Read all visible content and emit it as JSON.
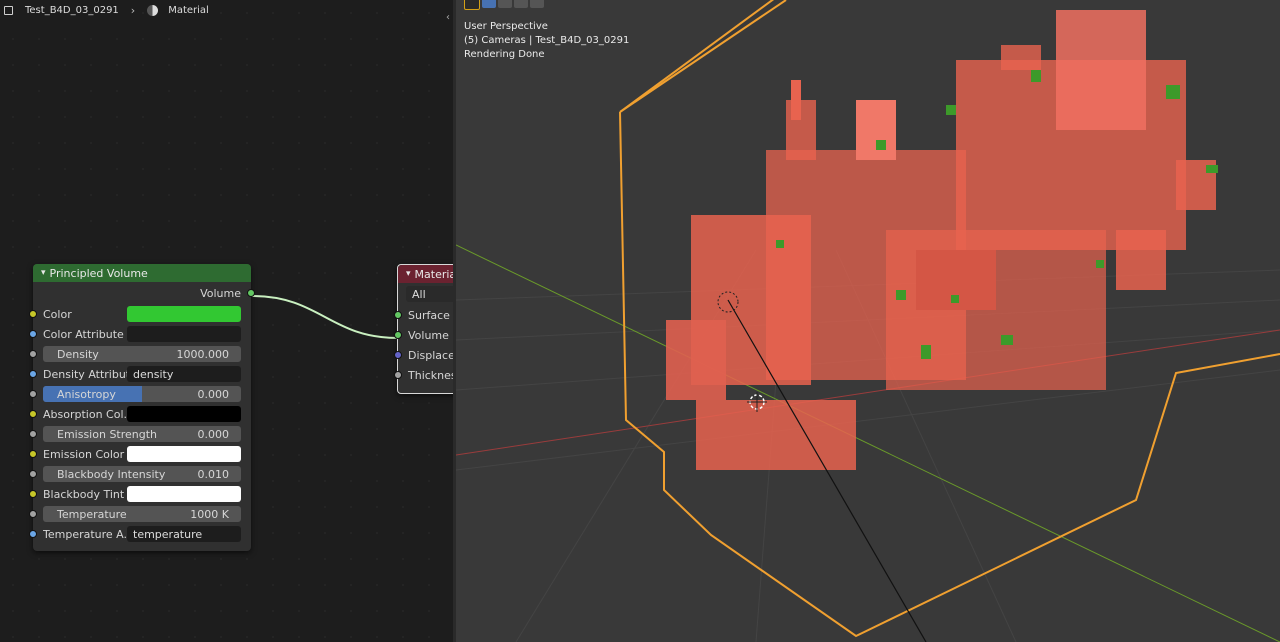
{
  "breadcrumb": {
    "object": "Test_B4D_03_0291",
    "material": "Material"
  },
  "principled_volume": {
    "title": "Principled Volume",
    "output_label": "Volume",
    "color_label": "Color",
    "color_value": "#32c832",
    "color_attribute_label": "Color Attribute",
    "color_attribute_value": "",
    "density_label": "Density",
    "density_value": "1000.000",
    "density_attribute_label": "Density Attribute",
    "density_attribute_value": "density",
    "anisotropy_label": "Anisotropy",
    "anisotropy_value": "0.000",
    "absorption_color_label": "Absorption Col...",
    "absorption_color_value": "#000000",
    "emission_strength_label": "Emission Strength",
    "emission_strength_value": "0.000",
    "emission_color_label": "Emission Color",
    "emission_color_value": "#ffffff",
    "blackbody_intensity_label": "Blackbody Intensity",
    "blackbody_intensity_value": "0.010",
    "blackbody_tint_label": "Blackbody Tint",
    "blackbody_tint_value": "#ffffff",
    "temperature_label": "Temperature",
    "temperature_value": "1000 K",
    "temperature_attribute_label": "Temperature A...",
    "temperature_attribute_value": "temperature"
  },
  "material_output": {
    "title": "Materia",
    "target": "All",
    "inputs": [
      "Surface",
      "Volume",
      "Displacem",
      "Thickness"
    ]
  },
  "viewport": {
    "line1": "User Perspective",
    "line2": "(5) Cameras | Test_B4D_03_0291",
    "line3": "Rendering Done"
  },
  "colors": {
    "node_header_green": "#2e6b31",
    "output_header_red": "#6b2230",
    "socket_green": "#63c763",
    "socket_blue": "#6ba6e6",
    "socket_grey": "#a1a1a1",
    "socket_yellow": "#c7c729",
    "socket_purple": "#6363c7",
    "bounding_box": "#f0a030",
    "volume_red": "#e8634f",
    "volume_green": "#3d9a2a"
  }
}
